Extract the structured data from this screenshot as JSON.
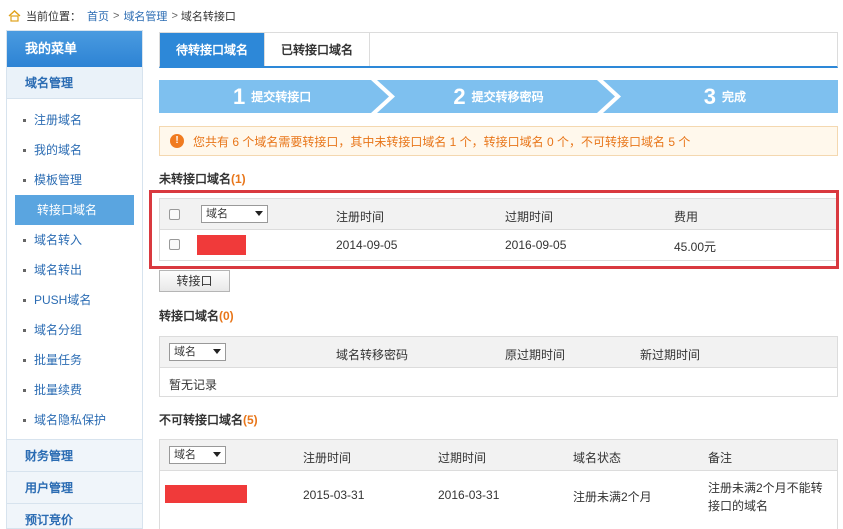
{
  "breadcrumb": {
    "prefix": "当前位置：",
    "home": "首页",
    "sep": ">",
    "section": "域名管理",
    "current": "域名转接口"
  },
  "sidebar": {
    "menu_title": "我的菜单",
    "group_title": "域名管理",
    "items": [
      {
        "label": "注册域名"
      },
      {
        "label": "我的域名"
      },
      {
        "label": "模板管理"
      },
      {
        "label": "转接口域名",
        "active": true
      },
      {
        "label": "域名转入"
      },
      {
        "label": "域名转出"
      },
      {
        "label": "PUSH域名"
      },
      {
        "label": "域名分组"
      },
      {
        "label": "批量任务"
      },
      {
        "label": "批量续费"
      },
      {
        "label": "域名隐私保护"
      }
    ],
    "sections": [
      "财务管理",
      "用户管理",
      "预订竞价"
    ]
  },
  "tabs": [
    "待转接口域名",
    "已转接口域名"
  ],
  "steps": [
    {
      "num": "1",
      "label": "提交转接口"
    },
    {
      "num": "2",
      "label": "提交转移密码"
    },
    {
      "num": "3",
      "label": "完成"
    }
  ],
  "notice": "您共有 6 个域名需要转接口，其中未转接口域名 1 个，转接口域名 0 个，不可转接口域名 5 个",
  "unconverted": {
    "title": "未转接口域名",
    "count": "(1)",
    "select": "域名",
    "headers": [
      "注册时间",
      "过期时间",
      "费用"
    ],
    "rows": [
      {
        "reg": "2014-09-05",
        "exp": "2016-09-05",
        "fee": "45.00元"
      }
    ],
    "button": "转接口"
  },
  "converted": {
    "title": "转接口域名",
    "count": "(0)",
    "select": "域名",
    "headers": [
      "域名转移密码",
      "原过期时间",
      "新过期时间"
    ],
    "empty": "暂无记录"
  },
  "blocked": {
    "title": "不可转接口域名",
    "count": "(5)",
    "select": "域名",
    "headers": [
      "注册时间",
      "过期时间",
      "域名状态",
      "备注"
    ],
    "rows": [
      {
        "reg": "2015-03-31",
        "exp": "2016-03-31",
        "status": "注册未满2个月",
        "note": "注册未满2个月不能转接口的域名"
      }
    ]
  },
  "colors": {
    "accent": "#2d88d8",
    "warning": "#e8761a",
    "highlight": "#d9393f",
    "redaction": "#f03a3a"
  }
}
